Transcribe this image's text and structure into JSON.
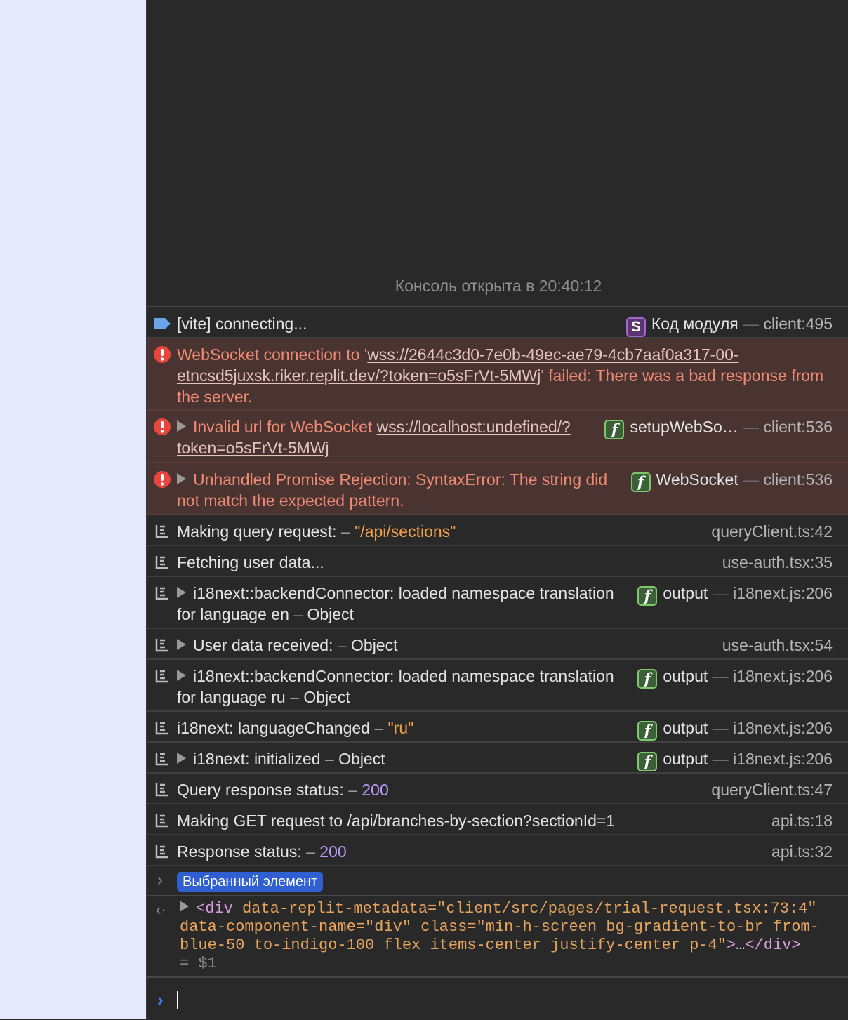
{
  "console": {
    "opened_text": "Консоль открыта в 20:40:12",
    "messages": [
      {
        "level": "info",
        "icon": "info-tag-icon",
        "expandable": false,
        "parts": [
          {
            "t": "text",
            "v": "[vite] connecting..."
          }
        ],
        "source": {
          "badge": "S",
          "fn": "Код модуля",
          "loc": "client:495"
        }
      },
      {
        "level": "error",
        "icon": "error-icon",
        "expandable": false,
        "parts": [
          {
            "t": "text",
            "v": "WebSocket connection to '"
          },
          {
            "t": "link",
            "v": "wss://2644c3d0-7e0b-49ec-ae79-4cb7aaf0a317-00-etncsd5juxsk.riker.replit.dev/?token=o5sFrVt-5MWj"
          },
          {
            "t": "text",
            "v": "' failed: There was a bad response from the server."
          }
        ]
      },
      {
        "level": "error",
        "icon": "error-icon",
        "expandable": true,
        "parts": [
          {
            "t": "text",
            "v": "Invalid url for WebSocket "
          },
          {
            "t": "link",
            "v": "wss://localhost:undefined/?token=o5sFrVt-5MWj"
          }
        ],
        "source": {
          "badge": "f",
          "fn": "setupWebSo…",
          "loc": "client:536"
        }
      },
      {
        "level": "error",
        "icon": "error-icon",
        "expandable": true,
        "parts": [
          {
            "t": "text",
            "v": "Unhandled Promise Rejection: SyntaxError: The string did not match the expected pattern."
          }
        ],
        "source": {
          "badge": "f",
          "fn": "WebSocket",
          "loc": "client:536"
        }
      },
      {
        "level": "log",
        "icon": "log-icon",
        "expandable": false,
        "parts": [
          {
            "t": "text",
            "v": "Making query request: "
          },
          {
            "t": "sep",
            "v": "– "
          },
          {
            "t": "str",
            "v": "\"/api/sections\""
          }
        ],
        "source": {
          "loc": "queryClient.ts:42"
        }
      },
      {
        "level": "log",
        "icon": "log-icon",
        "expandable": false,
        "parts": [
          {
            "t": "text",
            "v": "Fetching user data..."
          }
        ],
        "source": {
          "loc": "use-auth.tsx:35"
        }
      },
      {
        "level": "log",
        "icon": "log-icon",
        "expandable": true,
        "parts": [
          {
            "t": "text",
            "v": "i18next::backendConnector: loaded namespace translation for language en "
          },
          {
            "t": "sep",
            "v": "– "
          },
          {
            "t": "text",
            "v": "Object"
          }
        ],
        "source": {
          "badge": "f",
          "fn": "output",
          "loc": "i18next.js:206"
        }
      },
      {
        "level": "log",
        "icon": "log-icon",
        "expandable": true,
        "parts": [
          {
            "t": "text",
            "v": "User data received: "
          },
          {
            "t": "sep",
            "v": "– "
          },
          {
            "t": "text",
            "v": "Object"
          }
        ],
        "source": {
          "loc": "use-auth.tsx:54"
        }
      },
      {
        "level": "log",
        "icon": "log-icon",
        "expandable": true,
        "parts": [
          {
            "t": "text",
            "v": "i18next::backendConnector: loaded namespace translation for language ru "
          },
          {
            "t": "sep",
            "v": "– "
          },
          {
            "t": "text",
            "v": "Object"
          }
        ],
        "source": {
          "badge": "f",
          "fn": "output",
          "loc": "i18next.js:206"
        }
      },
      {
        "level": "log",
        "icon": "log-icon",
        "expandable": false,
        "parts": [
          {
            "t": "text",
            "v": "i18next: languageChanged "
          },
          {
            "t": "sep",
            "v": "– "
          },
          {
            "t": "str",
            "v": "\"ru\""
          }
        ],
        "source": {
          "badge": "f",
          "fn": "output",
          "loc": "i18next.js:206"
        }
      },
      {
        "level": "log",
        "icon": "log-icon",
        "expandable": true,
        "parts": [
          {
            "t": "text",
            "v": "i18next: initialized "
          },
          {
            "t": "sep",
            "v": "– "
          },
          {
            "t": "text",
            "v": "Object"
          }
        ],
        "source": {
          "badge": "f",
          "fn": "output",
          "loc": "i18next.js:206"
        }
      },
      {
        "level": "log",
        "icon": "log-icon",
        "expandable": false,
        "parts": [
          {
            "t": "text",
            "v": "Query response status: "
          },
          {
            "t": "sep",
            "v": "– "
          },
          {
            "t": "num",
            "v": "200"
          }
        ],
        "source": {
          "loc": "queryClient.ts:47"
        }
      },
      {
        "level": "log",
        "icon": "log-icon",
        "expandable": false,
        "parts": [
          {
            "t": "text",
            "v": "Making GET request to /api/branches-by-section?sectionId=1"
          }
        ],
        "source": {
          "loc": "api.ts:18"
        }
      },
      {
        "level": "log",
        "icon": "log-icon",
        "expandable": false,
        "parts": [
          {
            "t": "text",
            "v": "Response status: "
          },
          {
            "t": "sep",
            "v": "– "
          },
          {
            "t": "num",
            "v": "200"
          }
        ],
        "source": {
          "loc": "api.ts:32"
        }
      }
    ],
    "selected_element_label": "Выбранный элемент",
    "result": {
      "tag_open": "<div",
      "attr1_name": " data-replit-metadata=",
      "attr1_value": "\"client/src/pages/trial-request.tsx:73:4\"",
      "attr2_name": " data-component-name=",
      "attr2_value": "\"div\"",
      "attr3_name": " class=",
      "attr3_value": "\"min-h-screen bg-gradient-to-br from-blue-50 to-indigo-100 flex items-center justify-center p-4\"",
      "tag_close_gt": ">",
      "ellipsis": "…",
      "tag_end": "</div>",
      "var": "= $1"
    },
    "prompt_value": ""
  },
  "colors": {
    "error_bg": "#4a3431",
    "error_text": "#ef8a72",
    "string": "#f0a04b",
    "number": "#b89cf5",
    "selected_badge": "#2f5fd0",
    "prompt": "#3a82f7"
  }
}
